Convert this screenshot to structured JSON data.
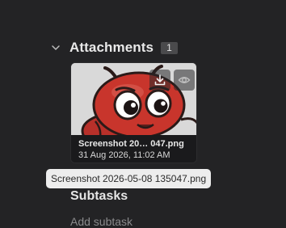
{
  "attachments": {
    "title": "Attachments",
    "count": "1",
    "file": {
      "name_truncated": "Screenshot 20… 047.png",
      "date": "31 Aug 2026, 11:02 AM",
      "tooltip": "Screenshot 2026-05-08 135047.png"
    },
    "actions": {
      "download_icon": "download-icon",
      "preview_icon": "eye-icon"
    }
  },
  "subtasks": {
    "title": "Subtasks",
    "add_label": "Add subtask"
  },
  "colors": {
    "background": "#232325",
    "badge": "#4a4a4c",
    "tooltip_bg": "#ededed",
    "ant_red": "#c8352c"
  }
}
